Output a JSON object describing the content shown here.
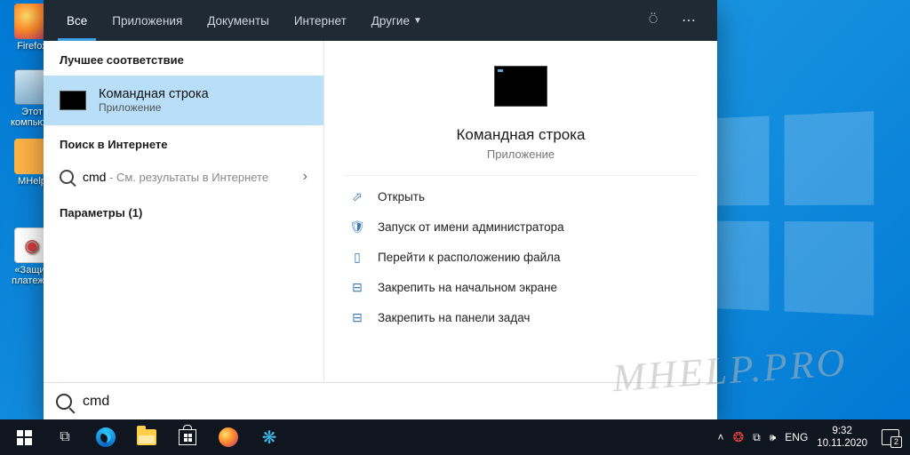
{
  "desktop": {
    "icons": [
      {
        "label": "Firefox"
      },
      {
        "label": "Этот компью..."
      },
      {
        "label": "MHelp"
      },
      {
        "label": "«Защит платеж..."
      }
    ]
  },
  "tabs": {
    "all": "Все",
    "apps": "Приложения",
    "docs": "Документы",
    "web": "Интернет",
    "other": "Другие"
  },
  "left": {
    "best_match_header": "Лучшее соответствие",
    "best_match_title": "Командная строка",
    "best_match_sub": "Приложение",
    "web_header": "Поиск в Интернете",
    "web_query": "cmd",
    "web_hint": " - См. результаты в Интернете",
    "settings_header": "Параметры (1)"
  },
  "preview": {
    "title": "Командная строка",
    "sub": "Приложение"
  },
  "actions": {
    "open": "Открыть",
    "admin": "Запуск от имени администратора",
    "location": "Перейти к расположению файла",
    "pin_start": "Закрепить на начальном экране",
    "pin_taskbar": "Закрепить на панели задач"
  },
  "search": {
    "value": "cmd"
  },
  "tray": {
    "lang": "ENG",
    "time": "9:32",
    "date": "10.11.2020"
  },
  "watermark": "MHELP.PRO"
}
